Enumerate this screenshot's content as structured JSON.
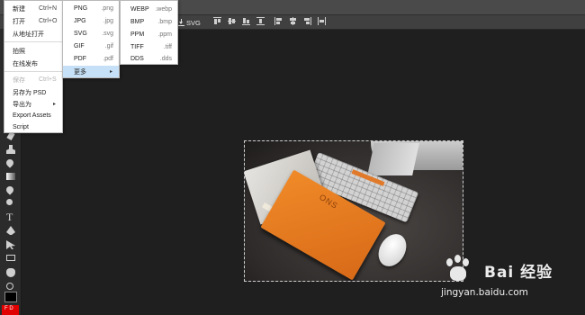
{
  "file_menu": {
    "items": [
      {
        "label": "新建",
        "shortcut": "Ctrl+N"
      },
      {
        "label": "打开",
        "shortcut": "Ctrl+O"
      },
      {
        "label": "从地址打开"
      },
      {
        "label": "拍照"
      },
      {
        "label": "在线发布"
      },
      {
        "label": "保存",
        "shortcut": "Ctrl+S",
        "disabled": true
      },
      {
        "label": "另存为 PSD"
      },
      {
        "label": "导出为"
      },
      {
        "label": "Export Assets"
      },
      {
        "label": "Script"
      }
    ]
  },
  "export_menu": {
    "items": [
      {
        "label": "PNG",
        "ext": ".png"
      },
      {
        "label": "JPG",
        "ext": ".jpg"
      },
      {
        "label": "SVG",
        "ext": ".svg"
      },
      {
        "label": "GIF",
        "ext": ".gif"
      },
      {
        "label": "PDF",
        "ext": ".pdf"
      },
      {
        "label": "更多",
        "arrow": "▸",
        "active": true
      }
    ]
  },
  "more_menu": {
    "items": [
      {
        "label": "WEBP",
        "ext": ".webp"
      },
      {
        "label": "BMP",
        "ext": ".bmp"
      },
      {
        "label": "PPM",
        "ext": ".ppm"
      },
      {
        "label": "TIFF",
        "ext": ".tiff"
      },
      {
        "label": "DDS",
        "ext": ".dds"
      }
    ]
  },
  "toolbar": {
    "export_svg_label": "SVG"
  },
  "canvas": {
    "book_title": "ONS"
  },
  "swatch": {
    "label": "F D"
  },
  "watermark": {
    "brand": "Bai 经验",
    "url": "jingyan.baidu.com"
  },
  "colors": {
    "menu_active": "#c6e1f7",
    "background": "#1f1f1f",
    "secondary_swatch": "#e00000"
  }
}
